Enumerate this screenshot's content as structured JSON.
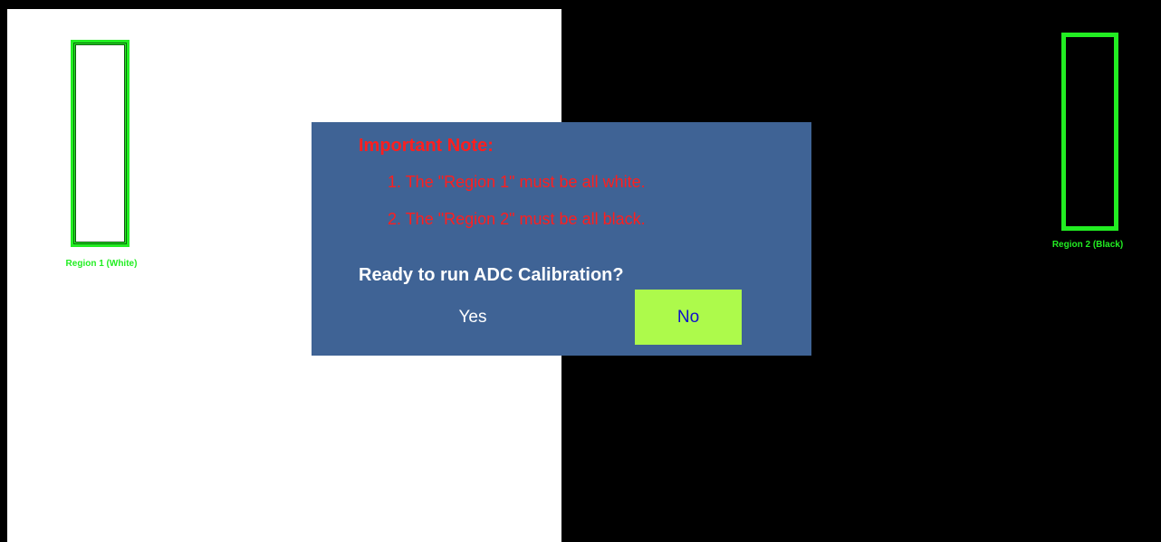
{
  "regions": {
    "region1_label": "Region 1 (White)",
    "region2_label": "Region 2 (Black)"
  },
  "dialog": {
    "note_title": "Important Note:",
    "note_lines": [
      "1. The \"Region 1\" must be all white.",
      "2. The \"Region 2\" must be all black."
    ],
    "question": "Ready to run ADC Calibration?",
    "yes_label": "Yes",
    "no_label": "No"
  },
  "colors": {
    "region_outline": "#22ee22",
    "dialog_bg": "#3f6395",
    "note_text": "#ff1e1e",
    "no_button_bg": "#adfa4b",
    "no_button_text": "#1010cc"
  }
}
